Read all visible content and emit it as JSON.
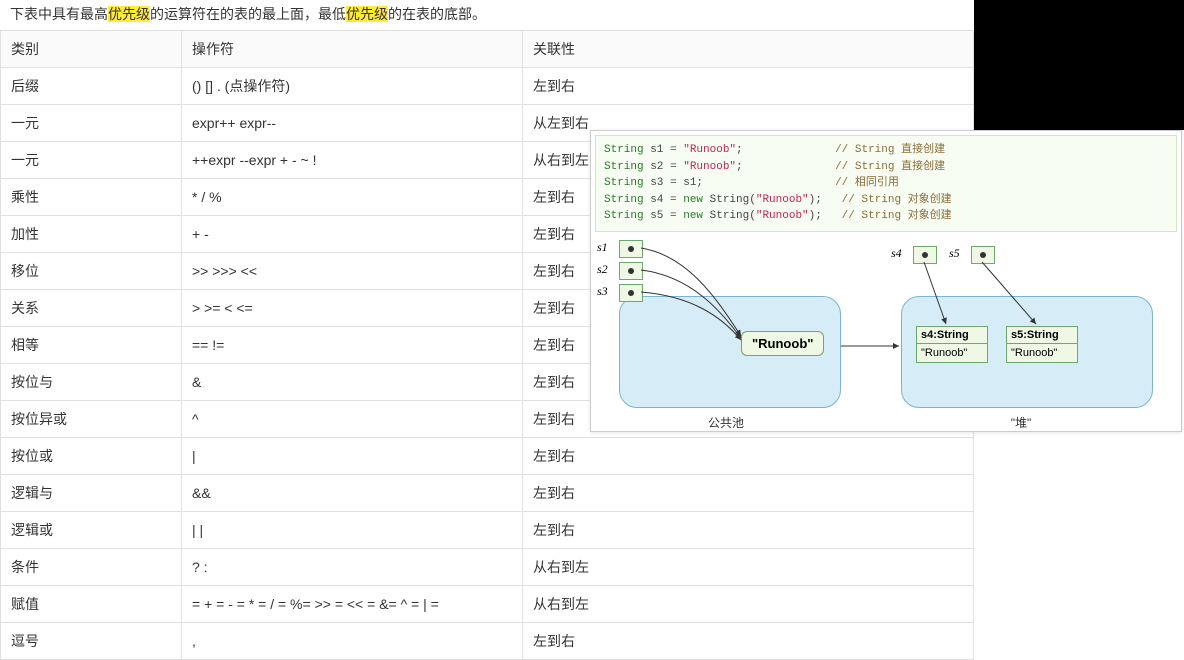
{
  "intro": {
    "pre1": "下表中具有最高",
    "hl1": "优先级",
    "mid": "的运算符在的表的最上面，最低",
    "hl2": "优先级",
    "post": "的在表的底部。"
  },
  "headers": {
    "cat": "类别",
    "ops": "操作符",
    "assoc": "关联性"
  },
  "rows": [
    {
      "cat": "后缀",
      "ops": "() [] . (点操作符)",
      "assoc": "左到右"
    },
    {
      "cat": "一元",
      "ops": "expr++ expr--",
      "assoc": "从左到右"
    },
    {
      "cat": "一元",
      "ops": "++expr --expr + - ~ !",
      "assoc": "从右到左"
    },
    {
      "cat": "乘性",
      "ops": "* / %",
      "assoc": "左到右"
    },
    {
      "cat": "加性",
      "ops": "+ -",
      "assoc": "左到右"
    },
    {
      "cat": "移位",
      "ops": ">> >>> <<",
      "assoc": "左到右"
    },
    {
      "cat": "关系",
      "ops": "> >= < <=",
      "assoc": "左到右"
    },
    {
      "cat": "相等",
      "ops": "== !=",
      "assoc": "左到右"
    },
    {
      "cat": "按位与",
      "ops": "&",
      "assoc": "左到右"
    },
    {
      "cat": "按位异或",
      "ops": "^",
      "assoc": "左到右"
    },
    {
      "cat": "按位或",
      "ops": "|",
      "assoc": "左到右"
    },
    {
      "cat": "逻辑与",
      "ops": "&&",
      "assoc": "左到右"
    },
    {
      "cat": "逻辑或",
      "ops": "| |",
      "assoc": "左到右"
    },
    {
      "cat": "条件",
      "ops": "? :",
      "assoc": "从右到左"
    },
    {
      "cat": "赋值",
      "ops": "= + = - = * = / = %= >> = << = &= ^ = | =",
      "assoc": "从右到左"
    },
    {
      "cat": "逗号",
      "ops": ",",
      "assoc": "左到右"
    }
  ],
  "code": {
    "l1a": "String",
    "l1b": " s1 = ",
    "l1c": "\"Runoob\"",
    "l1d": ";",
    "c1": "// String 直接创建",
    "l2a": "String",
    "l2b": " s2 = ",
    "l2c": "\"Runoob\"",
    "l2d": ";",
    "c2": "// String 直接创建",
    "l3a": "String",
    "l3b": " s3 = s1;",
    "c3": "// 相同引用",
    "l4a": "String",
    "l4b": " s4 = ",
    "l4n": "new",
    "l4c": " String(",
    "l4s": "\"Runoob\"",
    "l4d": ");",
    "c4": "// String 对象创建",
    "l5a": "String",
    "l5b": " s5 = ",
    "l5n": "new",
    "l5c": " String(",
    "l5s": "\"Runoob\"",
    "l5d": ");",
    "c5": "// String 对象创建"
  },
  "diagram": {
    "s1": "s1",
    "s2": "s2",
    "s3": "s3",
    "s4": "s4",
    "s5": "s5",
    "runoob": "\"Runoob\"",
    "ho1_hdr": "s4:String",
    "ho1_val": "\"Runoob\"",
    "ho2_hdr": "s5:String",
    "ho2_val": "\"Runoob\"",
    "pool_label": "公共池",
    "heap_label": "\"堆\""
  }
}
